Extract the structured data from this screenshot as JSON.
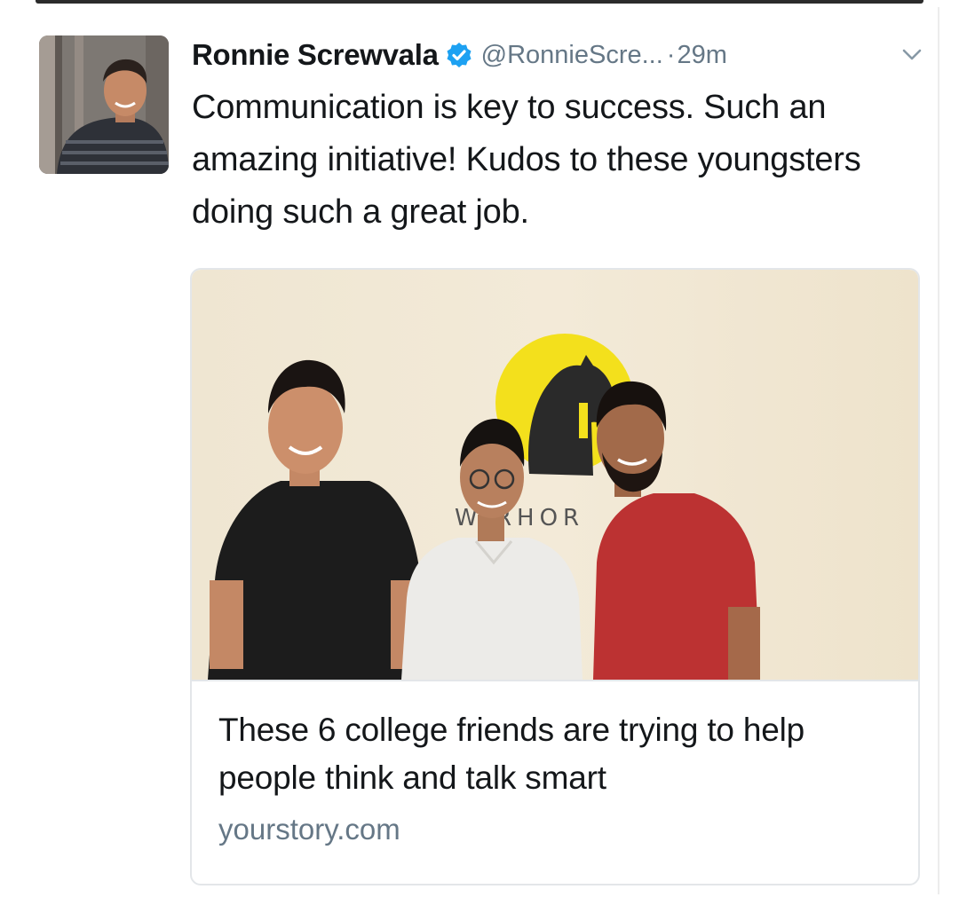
{
  "tweet": {
    "author_name": "Ronnie Screwvala",
    "handle": "@RonnieScre...",
    "separator": "·",
    "time": "29m",
    "text": "Communication is key to success. Such an amazing initiative! Kudos to these youngsters doing such a great job."
  },
  "icons": {
    "verified": "verified-badge-icon",
    "menu": "chevron-down-icon"
  },
  "card": {
    "title": "These 6 college friends are trying to help people think and talk smart",
    "domain": "yourstory.com",
    "wall_sign": "W RHOR"
  },
  "colors": {
    "text": "#14171a",
    "muted": "#657786",
    "verified": "#1da1f2",
    "logo_yellow": "#f3e01c"
  }
}
